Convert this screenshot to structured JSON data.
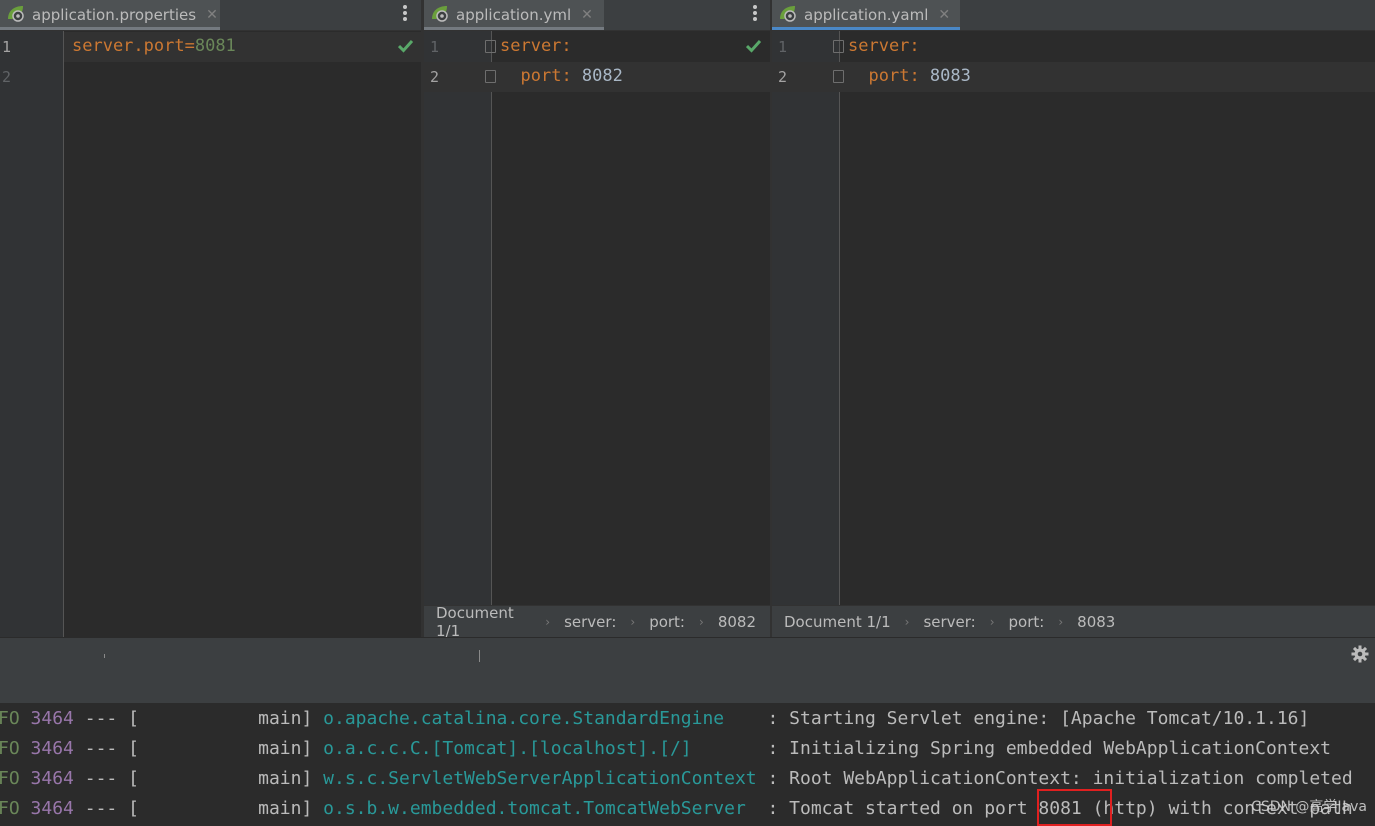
{
  "panes": [
    {
      "tab_label": "application.properties",
      "line_numbers": [
        "1",
        "2"
      ],
      "lines": [
        {
          "key": "server.port",
          "eq": "=",
          "value": "8081"
        }
      ]
    },
    {
      "tab_label": "application.yml",
      "line_numbers": [
        "1",
        "2"
      ],
      "lines": [
        {
          "key": "server",
          "colon": ":"
        },
        {
          "indent": "  ",
          "key": "port",
          "colon": ":",
          "value": " 8082"
        }
      ],
      "breadcrumb": [
        "Document 1/1",
        "server:",
        "port:",
        "8082"
      ]
    },
    {
      "tab_label": "application.yaml",
      "line_numbers": [
        "1",
        "2"
      ],
      "lines": [
        {
          "key": "server",
          "colon": ":"
        },
        {
          "indent": "  ",
          "key": "port",
          "colon": ":",
          "value": " 8083"
        }
      ],
      "breadcrumb": [
        "Document 1/1",
        "server:",
        "port:",
        "8083"
      ]
    }
  ],
  "console": {
    "rows": [
      {
        "level": "FO",
        "pid": "3464",
        "sep": " --- [",
        "thread": "           main]",
        "logger": "o.apache.catalina.core.StandardEngine   ",
        "msg": " : Starting Servlet engine: [Apache Tomcat/10.1.16]"
      },
      {
        "level": "FO",
        "pid": "3464",
        "sep": " --- [",
        "thread": "           main]",
        "logger": "o.a.c.c.C.[Tomcat].[localhost].[/]      ",
        "msg": " : Initializing Spring embedded WebApplicationContext"
      },
      {
        "level": "FO",
        "pid": "3464",
        "sep": " --- [",
        "thread": "           main]",
        "logger": "w.s.c.ServletWebServerApplicationContext",
        "msg": " : Root WebApplicationContext: initialization completed"
      },
      {
        "level": "FO",
        "pid": "3464",
        "sep": " --- [",
        "thread": "           main]",
        "logger": "o.s.b.w.embedded.tomcat.TomcatWebServer ",
        "msg": " : Tomcat started on port 8081 (http) with context path"
      }
    ]
  },
  "watermark": "CSDN @高学Java",
  "icons": {
    "file_icon": "spring-config-icon",
    "close": "close-icon",
    "more": "more-vert-icon",
    "settings": "gear-icon",
    "check": "check-icon"
  }
}
